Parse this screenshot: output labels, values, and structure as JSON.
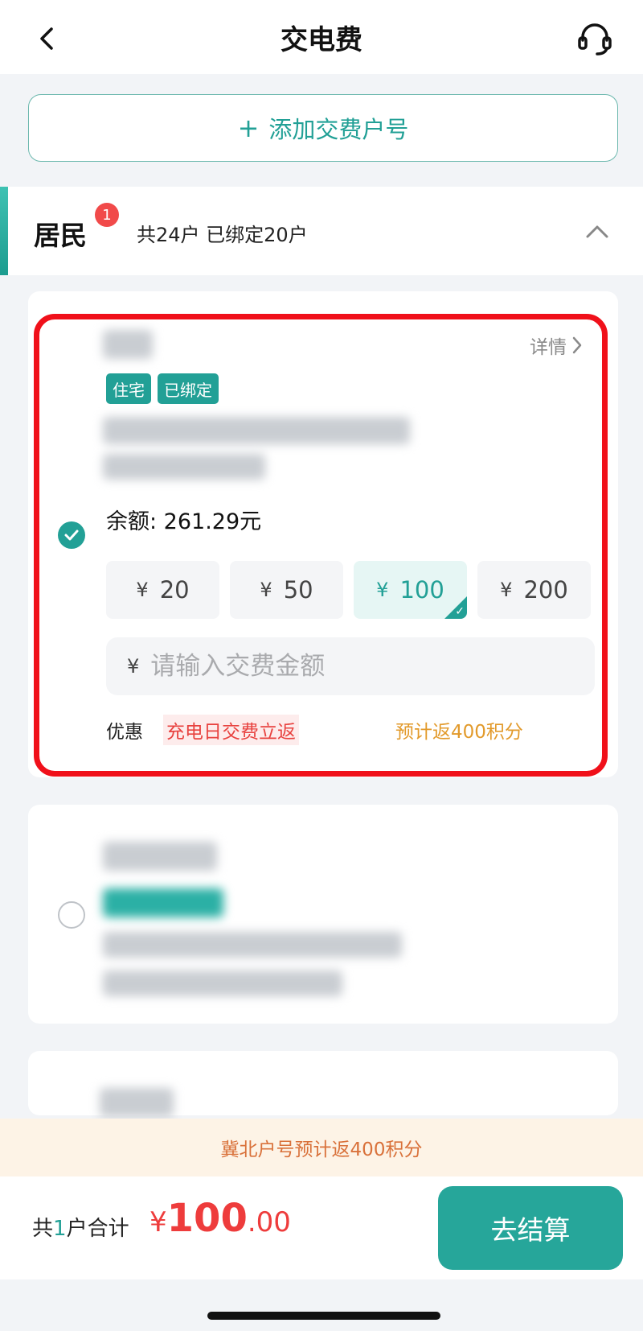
{
  "nav": {
    "title": "交电费"
  },
  "add_account": {
    "label": "添加交费户号",
    "plus": "+"
  },
  "section": {
    "title": "居民",
    "badge": "1",
    "count_text": "共24户 已绑定20户"
  },
  "card1": {
    "detail": "详情",
    "tags": [
      "住宅",
      "已绑定"
    ],
    "balance": "余额: 261.29元",
    "amounts": [
      {
        "yen": "¥",
        "value": "20"
      },
      {
        "yen": "¥",
        "value": "50"
      },
      {
        "yen": "¥",
        "value": "100"
      },
      {
        "yen": "¥",
        "value": "200"
      }
    ],
    "custom_amount": {
      "yen": "¥",
      "placeholder": "请输入交费金额"
    },
    "promo": {
      "label": "优惠",
      "tag": "充电日交费立返",
      "points": "预计返400积分"
    }
  },
  "notice": "冀北户号预计返400积分",
  "footer": {
    "total_prefix": "共",
    "total_count": "1",
    "total_suffix": "户合计",
    "amount_yen": "¥",
    "amount_int": "100",
    "amount_dec": ".00",
    "checkout": "去结算"
  },
  "colors": {
    "accent": "#22a096",
    "price": "#ee3c3c",
    "highlight": "#f0101a",
    "points": "#e29a2b"
  }
}
